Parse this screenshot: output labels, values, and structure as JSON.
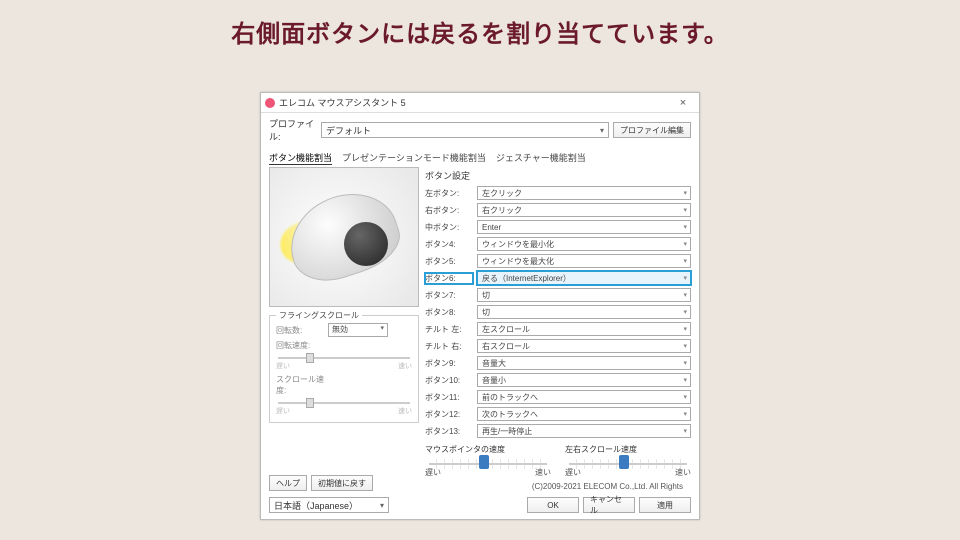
{
  "headline": "右側面ボタンには戻るを割り当てています。",
  "window": {
    "title": "エレコム マウスアシスタント 5",
    "profile_label": "プロファイル:",
    "profile_value": "デフォルト",
    "profile_edit": "プロファイル編集",
    "tabs": [
      "ボタン機能割当",
      "プレゼンテーションモード機能割当",
      "ジェスチャー機能割当"
    ],
    "group": "ボタン設定",
    "assignments": [
      {
        "label": "左ボタン:",
        "value": "左クリック"
      },
      {
        "label": "右ボタン:",
        "value": "右クリック"
      },
      {
        "label": "中ボタン:",
        "value": "Enter"
      },
      {
        "label": "ボタン4:",
        "value": "ウィンドウを最小化"
      },
      {
        "label": "ボタン5:",
        "value": "ウィンドウを最大化"
      },
      {
        "label": "ボタン6:",
        "value": "戻る（InternetExplorer）"
      },
      {
        "label": "ボタン7:",
        "value": "切"
      },
      {
        "label": "ボタン8:",
        "value": "切"
      },
      {
        "label": "チルト 左:",
        "value": "左スクロール"
      },
      {
        "label": "チルト 右:",
        "value": "右スクロール"
      },
      {
        "label": "ボタン9:",
        "value": "音量大"
      },
      {
        "label": "ボタン10:",
        "value": "音量小"
      },
      {
        "label": "ボタン11:",
        "value": "前のトラックへ"
      },
      {
        "label": "ボタン12:",
        "value": "次のトラックへ"
      },
      {
        "label": "ボタン13:",
        "value": "再生/一時停止"
      }
    ],
    "highlight_index": 5,
    "flying": {
      "legend": "フライングスクロール",
      "rotation_label": "回転数:",
      "rotation_value": "無効",
      "rot_speed_label": "回転速度:",
      "scroll_speed_label": "スクロール速度:",
      "slow": "遅い",
      "fast": "速い"
    },
    "pointer_speed": "マウスポインタの速度",
    "lr_scroll_speed": "左右スクロール速度",
    "slow": "遅い",
    "fast": "速い",
    "copyright": "(C)2009-2021 ELECOM Co.,Ltd. All Rights",
    "help": "ヘルプ",
    "reset": "初期値に戻す",
    "language": "日本語（Japanese）",
    "ok": "OK",
    "cancel": "キャンセル",
    "apply": "適用"
  }
}
